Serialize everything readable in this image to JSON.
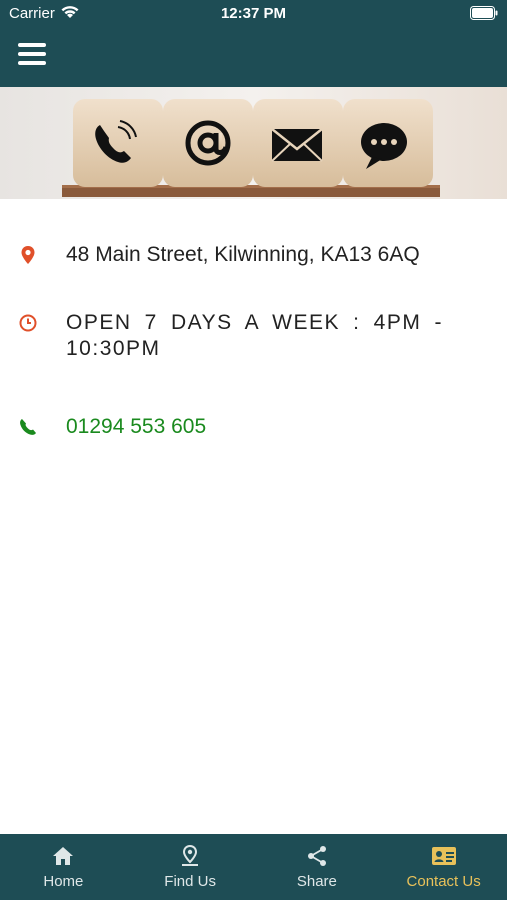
{
  "status_bar": {
    "carrier": "Carrier",
    "time": "12:37 PM"
  },
  "header": {
    "menu_icon": "hamburger-menu-icon",
    "background_color": "#1e4d55"
  },
  "banner": {
    "image": "contact-icons-wooden-cubes",
    "cubes": [
      "phone-icon",
      "at-sign-icon",
      "envelope-icon",
      "chat-bubble-icon"
    ]
  },
  "contact": {
    "address": "48 Main Street, Kilwinning, KA13 6AQ",
    "hours": "OPEN 7 DAYS A WEEK : 4PM - 10:30PM",
    "phone": "01294 553 605",
    "icon_color": "#e0502a",
    "phone_color": "#1a8a1e"
  },
  "tabbar": {
    "tabs": [
      {
        "label": "Home",
        "icon": "home-icon"
      },
      {
        "label": "Find Us",
        "icon": "map-pin-icon"
      },
      {
        "label": "Share",
        "icon": "share-icon"
      },
      {
        "label": "Contact Us",
        "icon": "contact-card-icon",
        "active": true
      }
    ],
    "active_color": "#e8c15a"
  }
}
